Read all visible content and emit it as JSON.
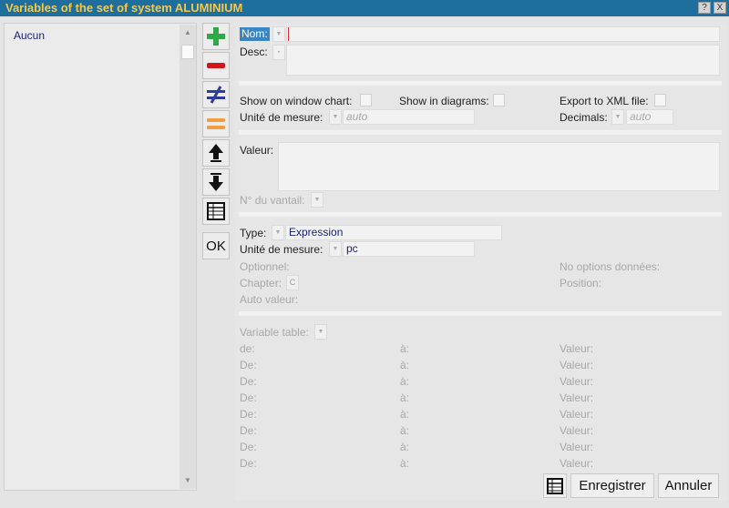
{
  "window": {
    "title": "Variables of the set  of system ALUMINIUM",
    "help_glyph": "?",
    "close_glyph": "X"
  },
  "list": {
    "items": [
      "Aucun"
    ]
  },
  "toolbar": {
    "ok_label": "OK"
  },
  "form": {
    "nom_label": "Nom:",
    "desc_label": "Desc:",
    "show_window_chart_label": "Show on window chart:",
    "show_diagrams_label": "Show in diagrams:",
    "export_xml_label": "Export to XML file:",
    "unite_mesure_label": "Unité de mesure:",
    "unite_mesure_value": "auto",
    "decimals_label": "Decimals:",
    "decimals_value": "auto",
    "valeur_label": "Valeur:",
    "vantail_label": "N° du vantail:",
    "type_label": "Type:",
    "type_value": "Expression",
    "unite_mesure2_label": "Unité de mesure:",
    "unite_mesure2_value": "pc",
    "optionnel_label": "Optionnel:",
    "no_options_label": "No options données:",
    "chapter_label": "Chapter:",
    "chapter_btn": "C",
    "position_label": "Position:",
    "auto_valeur_label": "Auto valeur:",
    "variable_table_label": "Variable table:",
    "table_rows": [
      {
        "de": "de:",
        "a": "à:",
        "valeur": "Valeur:"
      },
      {
        "de": "De:",
        "a": "à:",
        "valeur": "Valeur:"
      },
      {
        "de": "De:",
        "a": "à:",
        "valeur": "Valeur:"
      },
      {
        "de": "De:",
        "a": "à:",
        "valeur": "Valeur:"
      },
      {
        "de": "De:",
        "a": "à:",
        "valeur": "Valeur:"
      },
      {
        "de": "De:",
        "a": "à:",
        "valeur": "Valeur:"
      },
      {
        "de": "De:",
        "a": "à:",
        "valeur": "Valeur:"
      },
      {
        "de": "De:",
        "a": "à:",
        "valeur": "Valeur:"
      }
    ]
  },
  "footer": {
    "save_label": "Enregistrer",
    "cancel_label": "Annuler"
  },
  "colors": {
    "titlebar": "#1e6e9e",
    "title_text": "#f5c84a",
    "add": "#2fa84a",
    "remove": "#d0161b",
    "swap": "#2f3a9c",
    "equal": "#f0a040"
  }
}
